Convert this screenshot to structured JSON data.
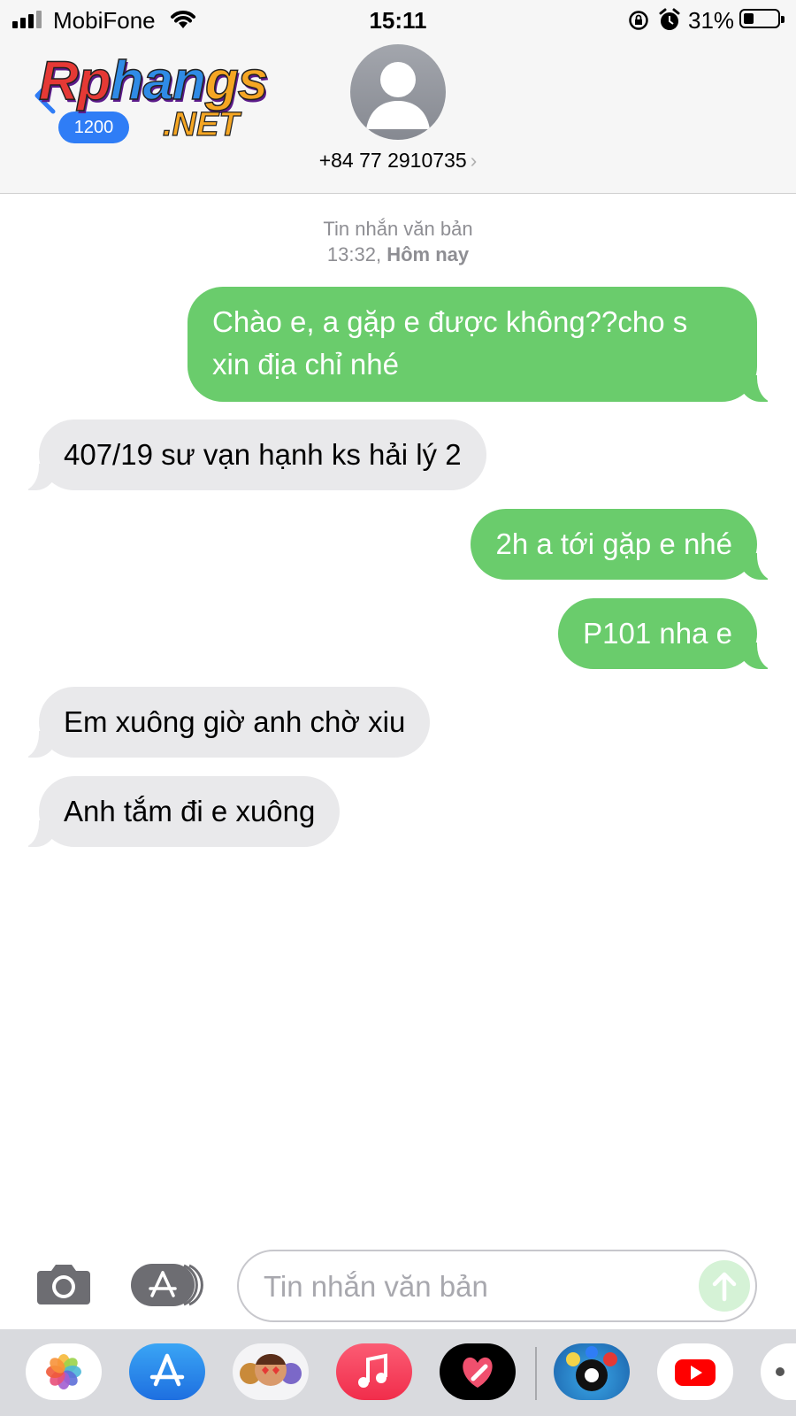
{
  "status_bar": {
    "carrier": "MobiFone",
    "time": "15:11",
    "battery_percent": "31%",
    "battery_level": 0.31
  },
  "header": {
    "back_badge": "1200",
    "watermark_logo": "Rphangs .NET",
    "contact_number": "+84 77 2910735",
    "contact_chevron": "›"
  },
  "thread": {
    "meta_type": "Tin nhắn văn bản",
    "meta_time": "13:32,",
    "meta_day": "Hôm nay",
    "messages": [
      {
        "direction": "out",
        "text": "Chào e, a gặp e được không??cho s xin địa chỉ nhé"
      },
      {
        "direction": "in",
        "text": "407/19 sư vạn hạnh ks hải lý 2"
      },
      {
        "direction": "out",
        "text": "2h a tới gặp e nhé"
      },
      {
        "direction": "out",
        "text": "P101 nha e"
      },
      {
        "direction": "in",
        "text": "Em xuông giờ anh chờ xiu"
      },
      {
        "direction": "in",
        "text": "Anh tắm đi e xuông"
      }
    ]
  },
  "compose": {
    "placeholder": "Tin nhắn văn bản",
    "value": ""
  },
  "dock": {
    "apps": [
      "photos-icon",
      "app-store-icon",
      "memoji-icon",
      "music-icon",
      "digital-touch-icon",
      "8-ball-pool-icon",
      "youtube-icon",
      "more-apps-icon"
    ]
  },
  "colors": {
    "outgoing_bubble": "#6acc6c",
    "incoming_bubble": "#e9e9eb",
    "accent": "#2f7df6"
  }
}
